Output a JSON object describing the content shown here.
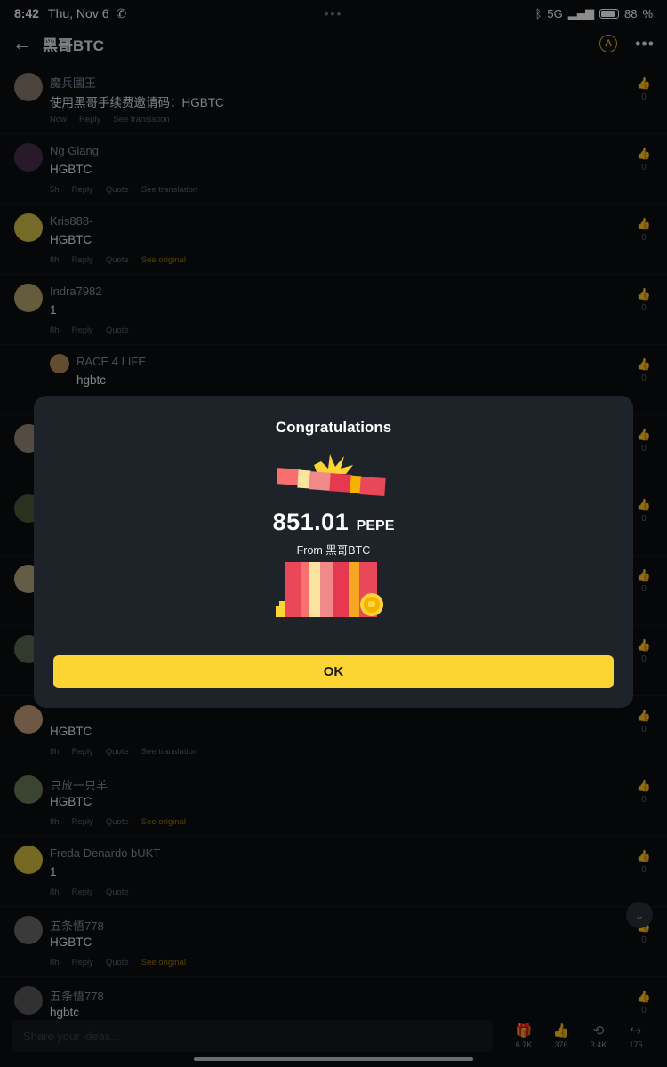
{
  "status": {
    "time": "8:42",
    "date": "Thu, Nov 6",
    "dots": "•••",
    "network": "5G",
    "battery": "88"
  },
  "header": {
    "back": "←",
    "title": "黑哥BTC",
    "more": "•••"
  },
  "comments": [
    {
      "name": "魔兵國王",
      "text": "使用黑哥手续费邀请码：HGBTC",
      "time": "Now",
      "actions": [
        "Reply",
        "See translation"
      ],
      "likes": "0"
    },
    {
      "name": "Ng Giang",
      "text": "HGBTC",
      "time": "5h",
      "actions": [
        "Reply",
        "Quote",
        "See translation"
      ],
      "likes": "0"
    },
    {
      "name": "Kris888-",
      "text": "HGBTC",
      "time": "8h",
      "actions": [
        "Reply",
        "Quote"
      ],
      "gold_action": "See original",
      "likes": "0"
    },
    {
      "name": "Indra7982",
      "text": "1",
      "time": "8h",
      "actions": [
        "Reply",
        "Quote"
      ],
      "likes": "0"
    },
    {
      "name": "RACE 4 LIFE",
      "text": "hgbtc",
      "time": "",
      "actions": [],
      "likes": "0"
    },
    {
      "name": "",
      "text": "",
      "time": "",
      "actions": [],
      "likes": "0"
    },
    {
      "name": "",
      "text": "",
      "time": "",
      "actions": [],
      "likes": "0"
    },
    {
      "name": "",
      "text": "",
      "time": "",
      "actions": [],
      "likes": "0"
    },
    {
      "name": "",
      "text": "",
      "time": "",
      "actions": [],
      "likes": "0"
    },
    {
      "name": "",
      "text": "HGBTC",
      "time": "8h",
      "actions": [
        "Reply",
        "Quote",
        "See translation"
      ],
      "likes": "0"
    },
    {
      "name": "只放一只羊",
      "text": "HGBTC",
      "time": "8h",
      "actions": [
        "Reply",
        "Quote"
      ],
      "gold_action": "See original",
      "likes": "0"
    },
    {
      "name": "Freda Denardo bUKT",
      "text": "1",
      "time": "8h",
      "actions": [
        "Reply",
        "Quote"
      ],
      "likes": "0"
    },
    {
      "name": "五条悟778",
      "text": "HGBTC",
      "time": "8h",
      "actions": [
        "Reply",
        "Quote"
      ],
      "gold_action": "See original",
      "likes": "0"
    },
    {
      "name": "五条悟778",
      "text": "hgbtc",
      "time": "",
      "actions": [],
      "likes": "0"
    }
  ],
  "modal": {
    "title": "Congratulations",
    "amount": "851.01",
    "currency": "PEPE",
    "from": "From 黑哥BTC",
    "ok": "OK"
  },
  "bottom": {
    "placeholder": "Share your ideas...",
    "gift_count": "6.7K",
    "like_count": "376",
    "repost_count": "3.4K",
    "share_count": "175"
  },
  "colors": {
    "accent": "#fcd535",
    "background": "#0b0e11",
    "modal_bg": "#1e2329"
  }
}
